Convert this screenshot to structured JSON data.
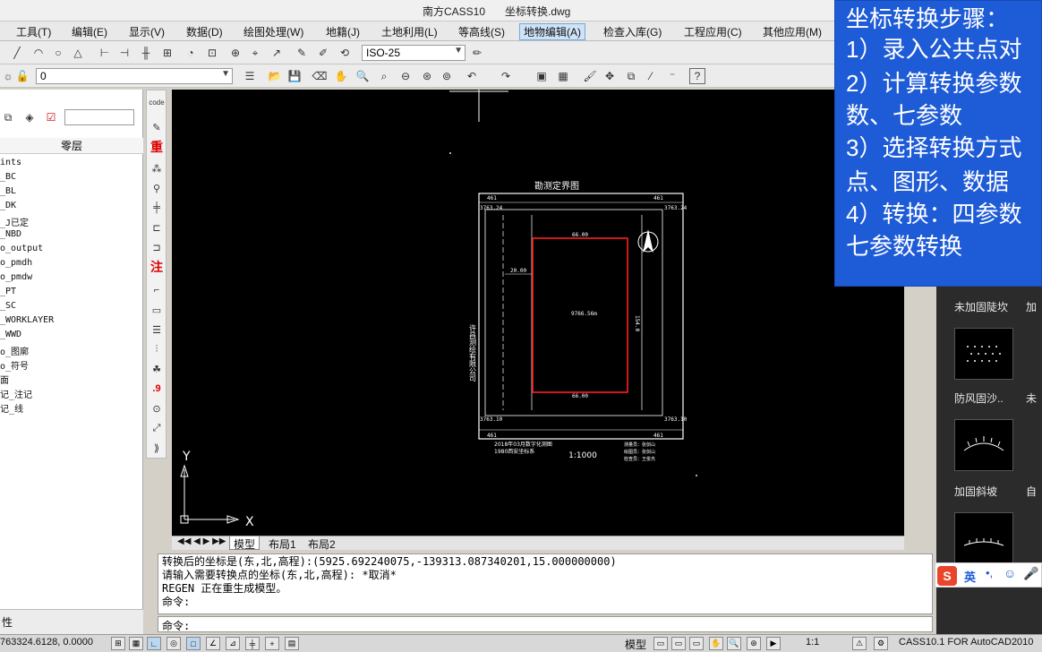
{
  "window": {
    "app_title": "南方CASS10",
    "doc_title": "坐标转换.dwg"
  },
  "menu": [
    "工具(T)",
    "编辑(E)",
    "显示(V)",
    "数据(D)",
    "绘图处理(W)",
    "地籍(J)",
    "土地利用(L)",
    "等高线(S)",
    "地物编辑(A)",
    "检查入库(G)",
    "工程应用(C)",
    "其他应用(M)"
  ],
  "toolbar": {
    "dimstyle": "ISO-25",
    "layer_value": "0"
  },
  "layers": {
    "header": "零层",
    "items": [
      "ints",
      "_BC",
      "_BL",
      "_DK",
      "_J已定",
      "_NBD",
      "o_output",
      "o_pmdh",
      "o_pmdw",
      "_PT",
      "_SC",
      "_WORKLAYER",
      "_WWD",
      "o_图廓",
      "o_符号",
      "面",
      "记_注记",
      "记_线"
    ],
    "bottom_label": "性"
  },
  "vtool_labels": {
    "code": "code",
    "zhong": "重",
    "zhu": "注",
    "nine": ".9"
  },
  "drawing": {
    "plot_title": "勘测定界图",
    "area": "9766.56m",
    "dim_top": "66.00",
    "dim_bottom": "66.00",
    "dim_left": "20.00",
    "dim_height": "154.0",
    "scale": "1:1000",
    "coord_tl": "461",
    "coord_tr": "461",
    "coord_bl": "461",
    "coord_br": "461",
    "grid_tl": "3763.24",
    "grid_tr": "3763.24",
    "grid_bl": "3763.10",
    "grid_br": "3763.10",
    "left_company": "许昌测绘有限公司",
    "note1": "2018年03月数字化测图",
    "note2": "1980西安坐标系",
    "sig1": "测量员：张剑山",
    "sig2": "绘图员：张剑山",
    "sig3": "检查员：王俊杰",
    "axis_y": "Y",
    "axis_x": "X"
  },
  "tabs": [
    "模型",
    "布局1",
    "布局2"
  ],
  "command": {
    "lines": [
      "转换后的坐标是(东,北,高程):(5925.692240075,-139313.087340201,15.000000000)",
      "请输入需要转换点的坐标(东,北,高程): *取消*",
      "REGEN 正在重生成模型。",
      "命令:"
    ],
    "prompt": "命令:"
  },
  "status": {
    "coords": "763324.6128, 0.0000",
    "model": "模型",
    "scale": "1:1",
    "version": "CASS10.1 FOR AutoCAD2010"
  },
  "gallery": [
    "未加固陡坎",
    "防风固沙..",
    "加固斜坡"
  ],
  "gallery_partial": [
    "加",
    "未",
    "自"
  ],
  "overlay": {
    "title": "坐标转换步骤：",
    "lines": [
      "1）录入公共点对",
      "2）计算转换参数",
      "数、七参数",
      "3）选择转换方式",
      "点、图形、数据",
      "4）转换：四参数",
      "七参数转换"
    ]
  },
  "ime": {
    "label": "英"
  }
}
